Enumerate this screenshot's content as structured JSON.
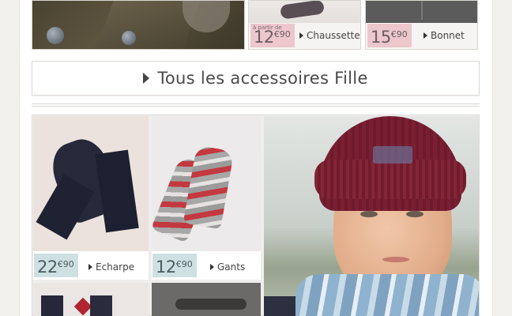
{
  "top_row": {
    "socks_tile": {
      "from_label": "à partir de",
      "price_int": "12",
      "price_dec": "€90",
      "link_label": "Chaussettes"
    },
    "hat_tile": {
      "price_int": "15",
      "price_dec": "€90",
      "link_label": "Bonnet"
    }
  },
  "banner": {
    "label": "Tous les accessoires Fille"
  },
  "grid": {
    "scarf": {
      "price_int": "22",
      "price_dec": "€90",
      "link_label": "Echarpe"
    },
    "gloves": {
      "price_int": "12",
      "price_dec": "€90",
      "link_label": "Gants"
    }
  },
  "colors": {
    "pink_chip": "#ecc7cc",
    "blue_chip": "#cfe0e3",
    "background": "#f3f1ee"
  }
}
